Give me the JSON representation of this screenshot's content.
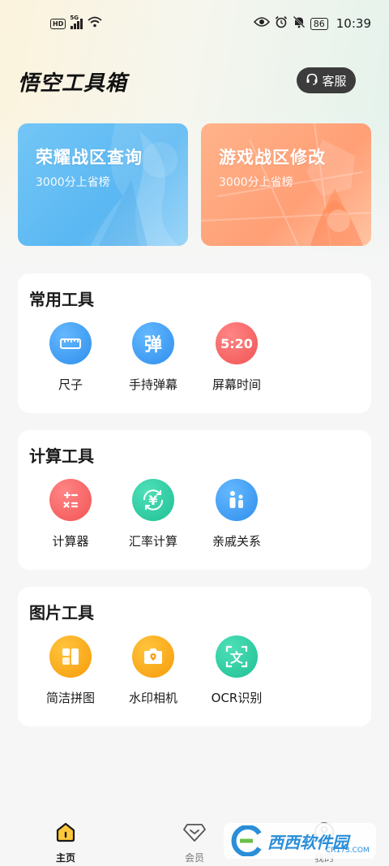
{
  "status_bar": {
    "hd": "HD",
    "network": "5G",
    "battery": "86",
    "time": "10:39"
  },
  "header": {
    "title": "悟空工具箱",
    "service_label": "客服"
  },
  "banners": [
    {
      "title": "荣耀战区查询",
      "subtitle": "3000分上省榜",
      "color": "#5ab7f2"
    },
    {
      "title": "游戏战区修改",
      "subtitle": "3000分上省榜",
      "color": "#ff9f76"
    }
  ],
  "sections": [
    {
      "title": "常用工具",
      "tools": [
        {
          "label": "尺子",
          "icon": "ruler-icon",
          "glyph": ""
        },
        {
          "label": "手持弹幕",
          "icon": "danmaku-icon",
          "glyph": "弹"
        },
        {
          "label": "屏幕时间",
          "icon": "screen-time-icon",
          "glyph": "5:20"
        }
      ]
    },
    {
      "title": "计算工具",
      "tools": [
        {
          "label": "计算器",
          "icon": "calculator-icon",
          "glyph": ""
        },
        {
          "label": "汇率计算",
          "icon": "exchange-rate-icon",
          "glyph": "¥"
        },
        {
          "label": "亲戚关系",
          "icon": "relatives-icon",
          "glyph": ""
        }
      ]
    },
    {
      "title": "图片工具",
      "tools": [
        {
          "label": "简洁拼图",
          "icon": "collage-icon",
          "glyph": ""
        },
        {
          "label": "水印相机",
          "icon": "watermark-camera-icon",
          "glyph": ""
        },
        {
          "label": "OCR识别",
          "icon": "ocr-icon",
          "glyph": "文"
        }
      ]
    }
  ],
  "bottom_nav": [
    {
      "label": "主页",
      "icon": "home-icon",
      "active": true
    },
    {
      "label": "会员",
      "icon": "vip-diamond-icon",
      "active": false
    },
    {
      "label": "我的",
      "icon": "profile-icon",
      "active": false
    }
  ],
  "watermark": {
    "text": "西西软件园",
    "sub": "CR173.COM"
  },
  "colors": {
    "blue": "#2f8fec",
    "red": "#f25454",
    "green": "#1fbf94",
    "orange": "#f79b0a",
    "dark_button": "#3c3c3c"
  }
}
